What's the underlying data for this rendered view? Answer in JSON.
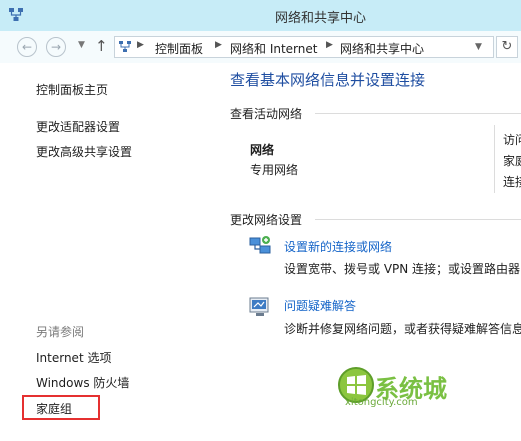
{
  "window": {
    "title": "网络和共享中心"
  },
  "navigation": {
    "back_icon": "back-arrow-icon",
    "forward_icon": "forward-arrow-icon",
    "up_icon": "up-arrow-icon",
    "breadcrumbs": [
      "控制面板",
      "网络和 Internet",
      "网络和共享中心"
    ],
    "refresh_icon": "refresh-icon"
  },
  "sidebar": {
    "links": [
      "控制面板主页",
      "更改适配器设置",
      "更改高级共享设置"
    ],
    "see_also_label": "另请参阅",
    "see_also_links": [
      "Internet 选项",
      "Windows 防火墙",
      "家庭组"
    ],
    "highlighted_item": "家庭组",
    "highlight_color": "#e53030"
  },
  "main": {
    "heading": "查看基本网络信息并设置连接",
    "active_networks": {
      "title": "查看活动网络",
      "network_name": "网络",
      "network_type": "专用网络",
      "right_column_clipped": [
        "访问",
        "家庭",
        "连接"
      ]
    },
    "change_settings": {
      "title": "更改网络设置",
      "tasks": [
        {
          "icon": "network-setup-icon",
          "link": "设置新的连接或网络",
          "desc": "设置宽带、拨号或 VPN 连接；或设置路由器"
        },
        {
          "icon": "troubleshoot-icon",
          "link": "问题疑难解答",
          "desc": "诊断并修复网络问题，或者获得疑难解答信息"
        }
      ]
    }
  },
  "watermark": {
    "text": "系统城",
    "url": "xitongcity.com"
  },
  "colors": {
    "titlebar": "#c7ecf7",
    "heading": "#1f4ea1",
    "link": "#1464c8"
  }
}
